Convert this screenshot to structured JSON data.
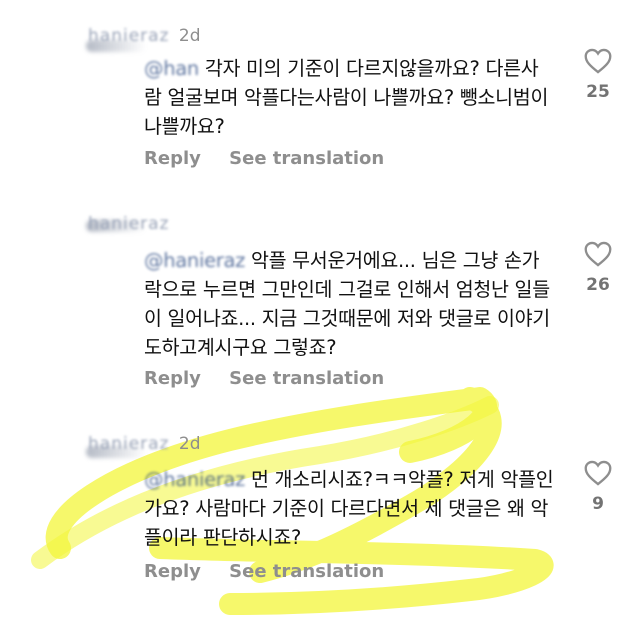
{
  "comments": [
    {
      "username": "hanieraz",
      "time": "2d",
      "mention": "@han",
      "text": " 각자 미의 기준이 다르지않을까요? 다른사람 얼굴보며 악플다는사람이 나쁠까요? 뺑소니범이 나쁠까요?",
      "reply": "Reply",
      "translate": "See translation",
      "likes": "25"
    },
    {
      "username": "hanieraz",
      "time": "",
      "mention": "@hanieraz",
      "text": " 악플 무서운거에요... 님은 그냥 손가락으로 누르면 그만인데 그걸로 인해서 엄청난 일들이 일어나죠... 지금 그것때문에 저와 댓글로 이야기도하고계시구요 그렇죠?",
      "reply": "Reply",
      "translate": "See translation",
      "likes": "26"
    },
    {
      "username": "hanieraz",
      "time": "2d",
      "mention": "@hanieraz",
      "text": " 먼 개소리시죠?ㅋㅋ악플? 저게 악플인가요? 사람마다 기준이 다르다면서 제 댓글은 왜 악플이라 판단하시죠?",
      "reply": "Reply",
      "translate": "See translation",
      "likes": "9"
    }
  ],
  "icons": {
    "like": "heart-outline-icon"
  },
  "colors": {
    "highlight": "#f3f53a",
    "secondary_text": "#8e8e8e"
  }
}
